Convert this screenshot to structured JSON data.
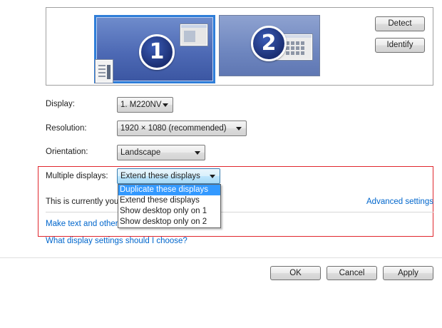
{
  "arrangement": {
    "monitor1_number": "1",
    "monitor2_number": "2",
    "detect_label": "Detect",
    "identify_label": "Identify"
  },
  "settings": {
    "display_label": "Display:",
    "display_value": "1. M220NV",
    "resolution_label": "Resolution:",
    "resolution_value": "1920 × 1080 (recommended)",
    "orientation_label": "Orientation:",
    "orientation_value": "Landscape",
    "multiple_label": "Multiple displays:",
    "multiple_value": "Extend these displays"
  },
  "dropdown": {
    "options": [
      "Duplicate these displays",
      "Extend these displays",
      "Show desktop only on 1",
      "Show desktop only on 2"
    ],
    "highlighted_index": 0
  },
  "info": {
    "current_text": "This is currently you",
    "advanced_link": "Advanced settings",
    "make_text_link": "Make text and other items larger or smaller",
    "what_settings_link": "What display settings should I choose?"
  },
  "footer": {
    "ok_label": "OK",
    "cancel_label": "Cancel",
    "apply_label": "Apply"
  },
  "colors": {
    "accent_link": "#0066cc",
    "selection": "#3399ff",
    "highlight_border": "#e0262d",
    "monitor_blue": "#4e6ab5"
  }
}
